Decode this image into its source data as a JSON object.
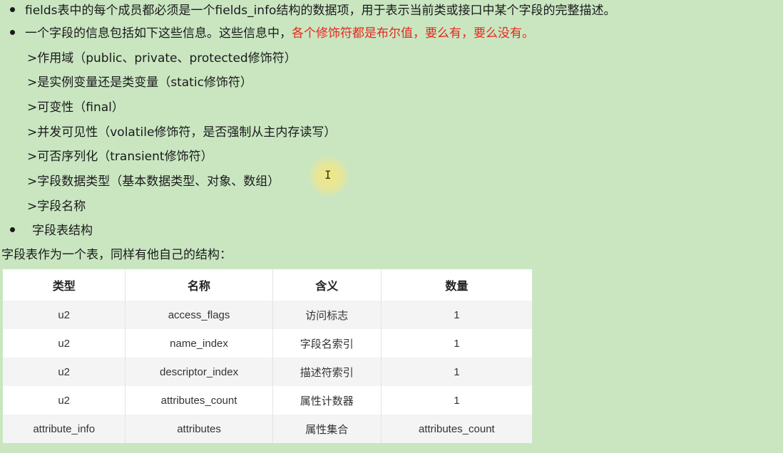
{
  "bullets": [
    {
      "text": "fields表中的每个成员都必须是一个fields_info结构的数据项，用于表示当前类或接口中某个字段的完整描述。"
    },
    {
      "text": "一个字段的信息包括如下这些信息。这些信息中，",
      "highlight": "各个修饰符都是布尔值，要么有，要么没有。"
    }
  ],
  "sub_items": [
    ">作用域（public、private、protected修饰符）",
    ">是实例变量还是类变量（static修饰符）",
    ">可变性（final）",
    ">并发可见性（volatile修饰符，是否强制从主内存读写）",
    ">可否序列化（transient修饰符）",
    ">字段数据类型（基本数据类型、对象、数组）",
    ">字段名称"
  ],
  "section_heading": "字段表结构",
  "intro_line": "字段表作为一个表，同样有他自己的结构：",
  "table": {
    "headers": [
      "类型",
      "名称",
      "含义",
      "数量"
    ],
    "rows": [
      [
        "u2",
        "access_flags",
        "访问标志",
        "1"
      ],
      [
        "u2",
        "name_index",
        "字段名索引",
        "1"
      ],
      [
        "u2",
        "descriptor_index",
        "描述符索引",
        "1"
      ],
      [
        "u2",
        "attributes_count",
        "属性计数器",
        "1"
      ],
      [
        "attribute_info",
        "attributes",
        "属性集合",
        "attributes_count"
      ]
    ]
  },
  "colors": {
    "background": "#c9e6c1",
    "highlight": "#e8261d"
  }
}
